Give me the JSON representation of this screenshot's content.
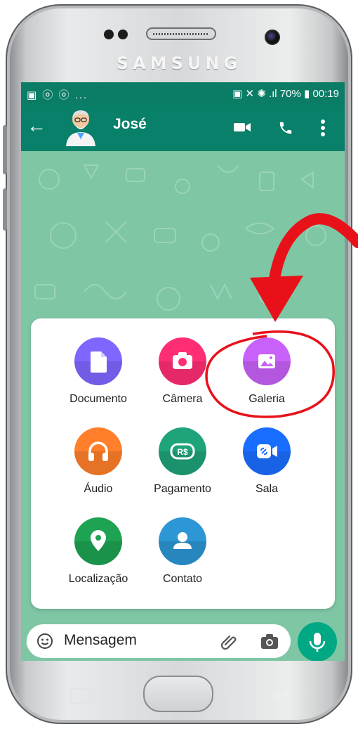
{
  "device": {
    "brand": "SAMSUNG"
  },
  "status_bar": {
    "left_icons": "▣ ⓞ ⓞ ...",
    "battery": "70%",
    "time": "00:19"
  },
  "chat": {
    "contact_name": "José"
  },
  "attachments": [
    {
      "label": "Documento",
      "color": "#7f66ff",
      "icon": "document-icon"
    },
    {
      "label": "Câmera",
      "color": "#ff2e74",
      "icon": "camera-icon"
    },
    {
      "label": "Galeria",
      "color": "#c861f9",
      "icon": "gallery-icon"
    },
    {
      "label": "Áudio",
      "color": "#ff7f2a",
      "icon": "headphones-icon"
    },
    {
      "label": "Pagamento",
      "color": "#1fa37a",
      "icon": "payment-icon"
    },
    {
      "label": "Sala",
      "color": "#1a6eff",
      "icon": "video-link-icon"
    },
    {
      "label": "Localização",
      "color": "#1ea352",
      "icon": "location-icon"
    },
    {
      "label": "Contato",
      "color": "#2d96d4",
      "icon": "contact-icon"
    }
  ],
  "composer": {
    "placeholder": "Mensagem"
  },
  "colors": {
    "header": "#08806a",
    "annotation": "#e8111a",
    "mic": "#00a884"
  }
}
